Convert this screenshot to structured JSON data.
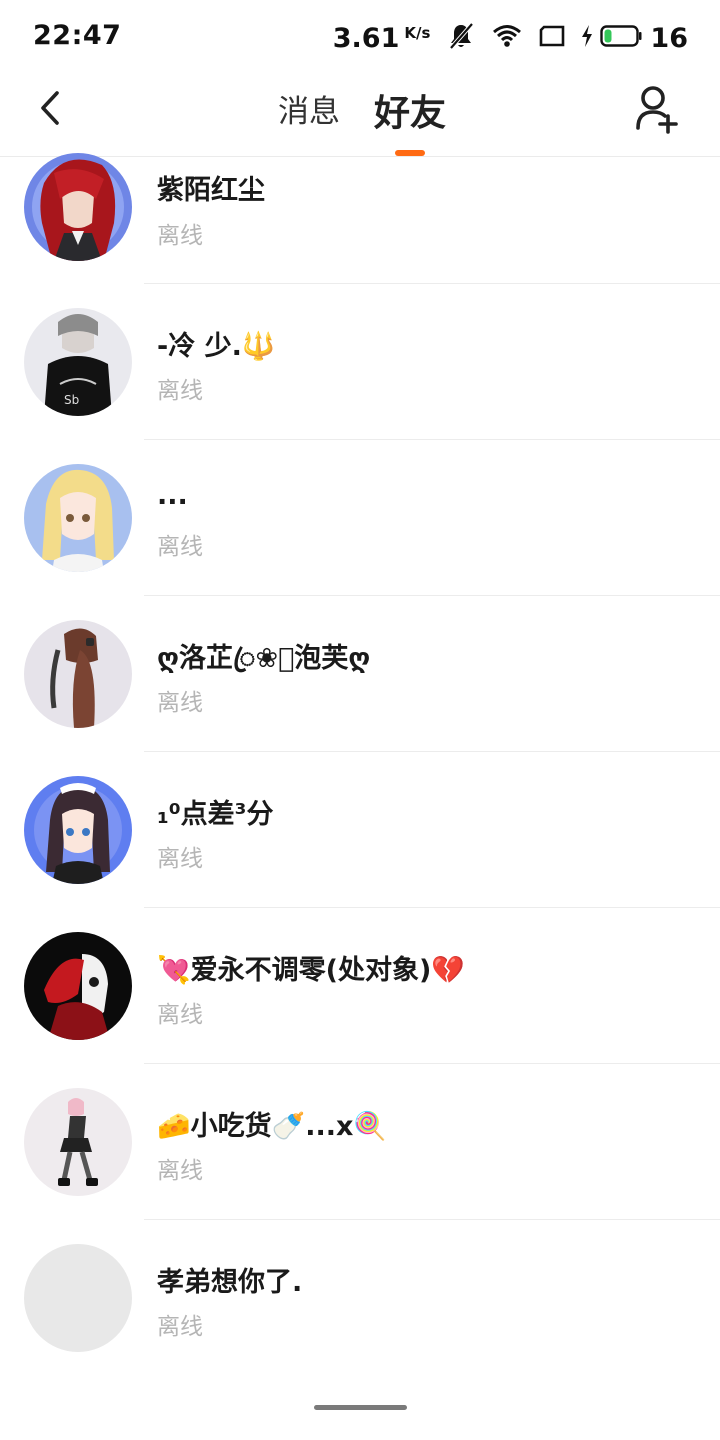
{
  "status_bar": {
    "time": "22:47",
    "net_speed": "3.61",
    "net_unit": "K/s",
    "battery_level": "16",
    "icons": [
      "mute-bell-icon",
      "wifi-icon",
      "screen-icon",
      "charging-icon",
      "battery-icon"
    ]
  },
  "nav": {
    "back_icon": "chevron-left-icon",
    "tabs": [
      {
        "label": "消息",
        "active": false
      },
      {
        "label": "好友",
        "active": true
      }
    ],
    "add_friend_icon": "add-user-icon",
    "accent_color": "#ff6a13"
  },
  "friends": [
    {
      "name": "紫陌红尘",
      "status": "离线",
      "avatar": "avatar-red-hair"
    },
    {
      "name": "-冷 少.🔱",
      "status": "离线",
      "avatar": "avatar-black-hoodie"
    },
    {
      "name": "...",
      "status": "离线",
      "avatar": "avatar-blonde"
    },
    {
      "name": "ღ洛芷ꦿ❀⃝泡芙ღ",
      "status": "离线",
      "avatar": "avatar-brown-ponytail"
    },
    {
      "name": "₁⁰点差³分",
      "status": "离线",
      "avatar": "avatar-maid"
    },
    {
      "name": "💘爱永不调零(处对象)💔",
      "status": "离线",
      "avatar": "avatar-dark-red"
    },
    {
      "name": "🧀小吃货🍼...x🍭",
      "status": "离线",
      "avatar": "avatar-chibi"
    },
    {
      "name": "孝弟想你了.",
      "status": "离线",
      "avatar": "avatar-empty"
    }
  ]
}
